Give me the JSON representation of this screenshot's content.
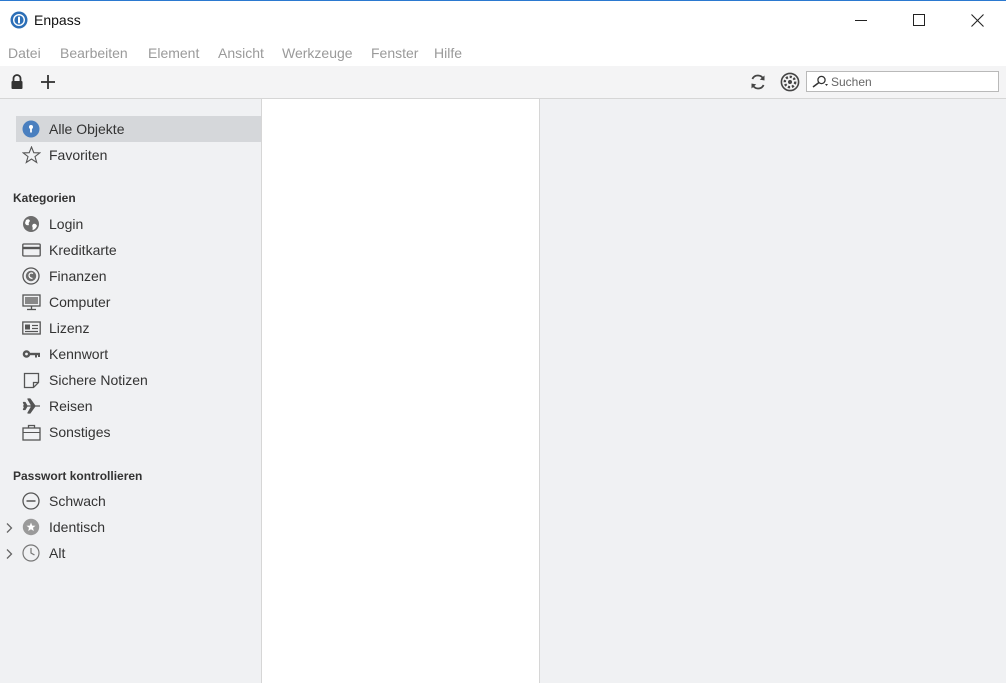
{
  "window": {
    "title": "Enpass",
    "accent_color": "#2b79d0"
  },
  "menu": {
    "items": [
      "Datei",
      "Bearbeiten",
      "Element",
      "Ansicht",
      "Werkzeuge",
      "Fenster",
      "Hilfe"
    ]
  },
  "toolbar": {
    "lock_icon": "lock-icon",
    "add_icon": "plus-icon",
    "sync_icon": "sync-icon",
    "settings_icon": "gear-icon",
    "search_placeholder": "Suchen",
    "search_value": ""
  },
  "sidebar": {
    "top_items": [
      {
        "label": "Alle Objekte",
        "icon": "enpass-key-icon",
        "selected": true
      },
      {
        "label": "Favoriten",
        "icon": "star-icon",
        "selected": false
      }
    ],
    "categories_title": "Kategorien",
    "categories": [
      {
        "label": "Login",
        "icon": "globe-icon"
      },
      {
        "label": "Kreditkarte",
        "icon": "credit-card-icon"
      },
      {
        "label": "Finanzen",
        "icon": "coin-icon"
      },
      {
        "label": "Computer",
        "icon": "monitor-icon"
      },
      {
        "label": "Lizenz",
        "icon": "license-icon"
      },
      {
        "label": "Kennwort",
        "icon": "key-icon"
      },
      {
        "label": "Sichere Notizen",
        "icon": "note-icon"
      },
      {
        "label": "Reisen",
        "icon": "airplane-icon"
      },
      {
        "label": "Sonstiges",
        "icon": "briefcase-icon"
      }
    ],
    "audit_title": "Passwort kontrollieren",
    "audit": [
      {
        "label": "Schwach",
        "icon": "minus-circle-icon",
        "expandable": false
      },
      {
        "label": "Identisch",
        "icon": "duplicate-icon",
        "expandable": true
      },
      {
        "label": "Alt",
        "icon": "clock-icon",
        "expandable": true
      }
    ]
  }
}
